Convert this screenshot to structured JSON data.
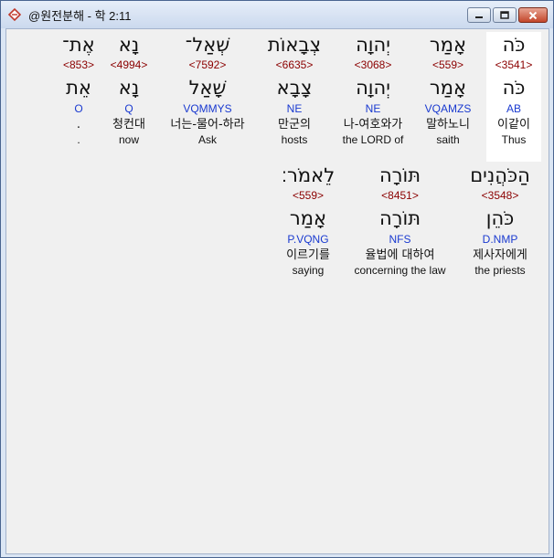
{
  "window": {
    "title": "@원전분해 - 학 2:11"
  },
  "rows": [
    {
      "words": [
        {
          "hebrew": "כֹּה",
          "strong": "<3541>",
          "lemma": "כֹּה",
          "morph": "AB",
          "korean": "이같이",
          "english": "Thus",
          "highlighted": true
        },
        {
          "hebrew": "אָמַר",
          "strong": "<559>",
          "lemma": "אָמַר",
          "morph": "VQAMZS",
          "korean": "말하노니",
          "english": "saith",
          "highlighted": false
        },
        {
          "hebrew": "יְהוָה",
          "strong": "<3068>",
          "lemma": "יְהוָה",
          "morph": "NE",
          "korean": "나-여호와가",
          "english": "the LORD of",
          "highlighted": false
        },
        {
          "hebrew": "צְבָאוֹת",
          "strong": "<6635>",
          "lemma": "צָבָא",
          "morph": "NE",
          "korean": "만군의",
          "english": "hosts",
          "highlighted": false
        },
        {
          "hebrew": "שְׁאַל־",
          "strong": "<7592>",
          "lemma": "שָׁאַל",
          "morph": "VQMMYS",
          "korean": "너는-물어-하라",
          "english": "Ask",
          "highlighted": false
        },
        {
          "hebrew": "נָא",
          "strong": "<4994>",
          "lemma": "נָא",
          "morph": "Q",
          "korean": "청컨대",
          "english": "now",
          "highlighted": false
        },
        {
          "hebrew": "אֶת־",
          "strong": "<853>",
          "lemma": "אֵת",
          "morph": "O",
          "korean": ".",
          "english": ".",
          "highlighted": false
        }
      ]
    },
    {
      "words": [
        {
          "hebrew": "הַכֹּהֲנִים",
          "strong": "<3548>",
          "lemma": "כֹּהֵן",
          "morph": "D.NMP",
          "korean": "제사자에게",
          "english": "the priests",
          "highlighted": false
        },
        {
          "hebrew": "תּוֹרָה",
          "strong": "<8451>",
          "lemma": "תּוֹרָה",
          "morph": "NFS",
          "korean": "율법에 대하여",
          "english": "concerning the law",
          "highlighted": false
        },
        {
          "hebrew": "לֵאמֹר׃",
          "strong": "<559>",
          "lemma": "אָמַר",
          "morph": "P.VQNG",
          "korean": "이르기를",
          "english": "saying",
          "highlighted": false
        }
      ]
    }
  ]
}
